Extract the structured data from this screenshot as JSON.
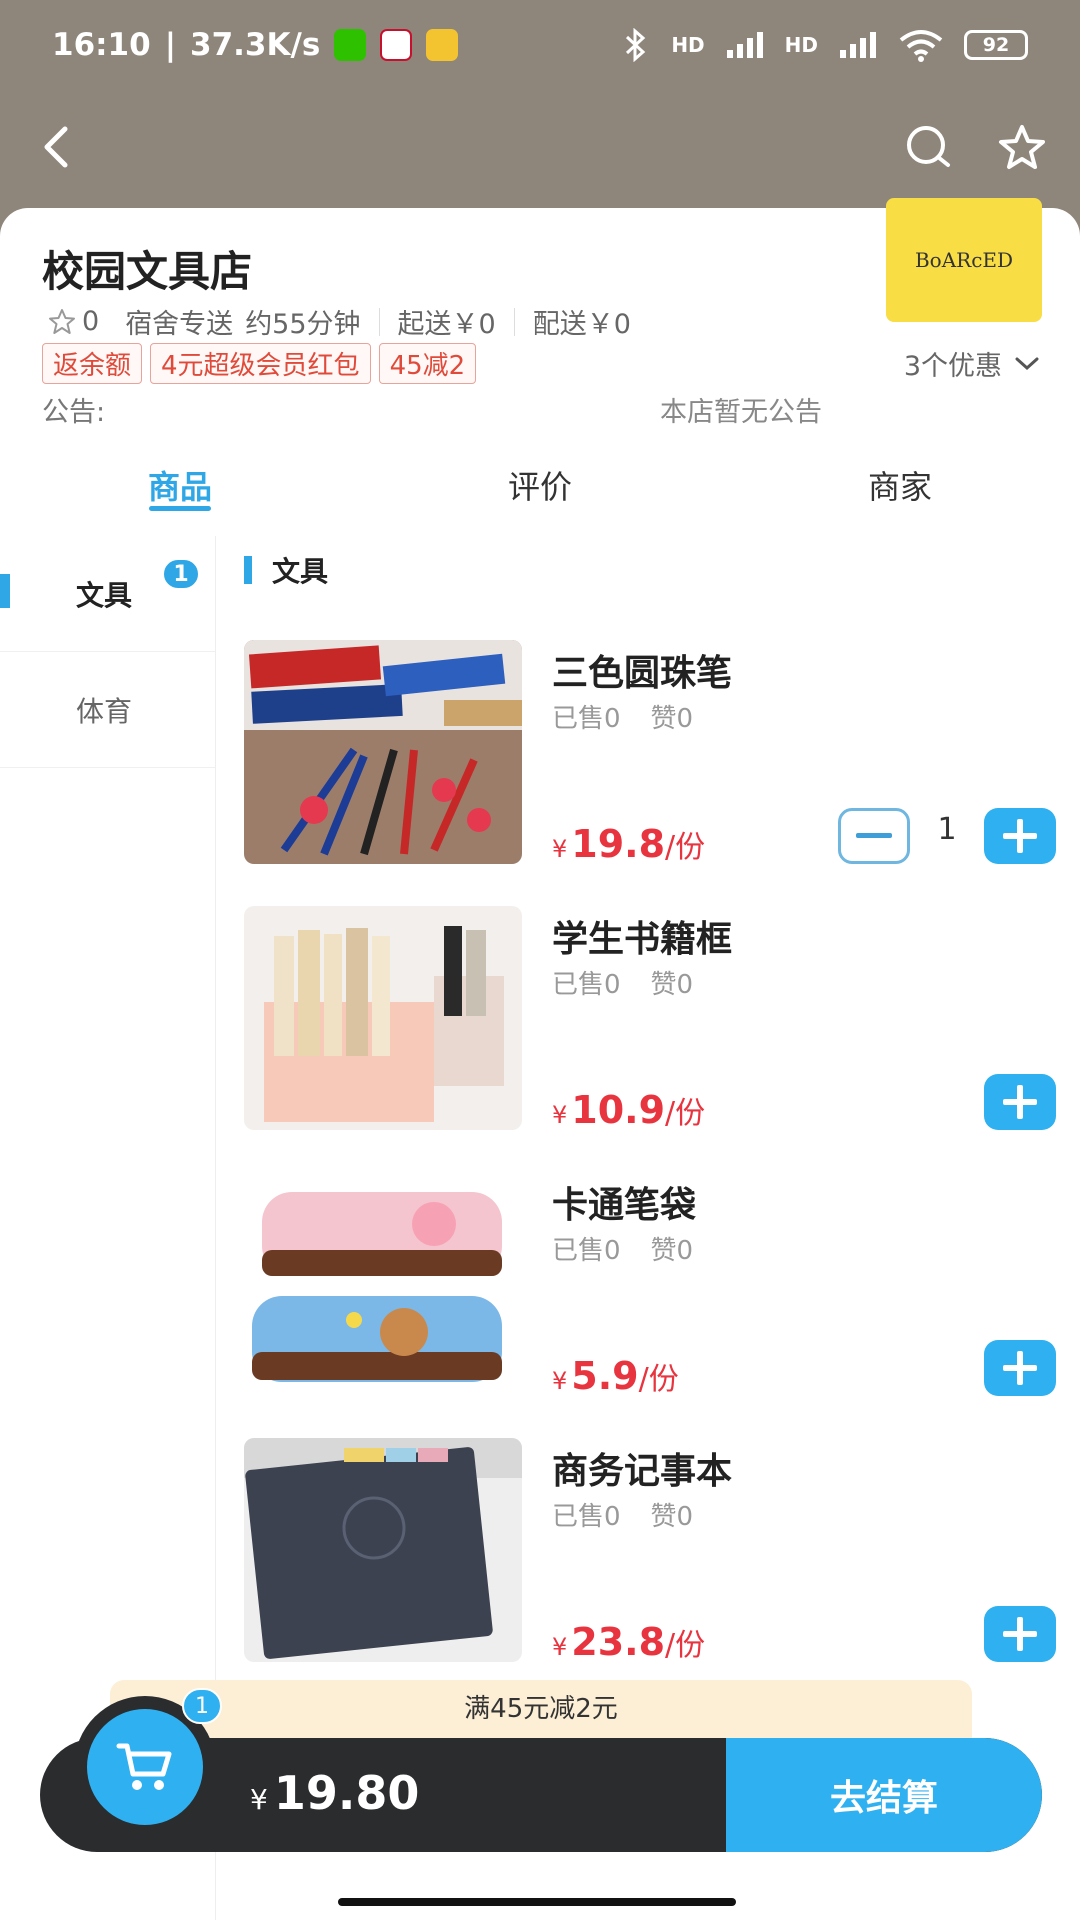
{
  "statusbar": {
    "time": "16:10",
    "speed": "37.3K/s",
    "battery": "92",
    "app_icons": [
      "wechat-icon",
      "kfc-icon",
      "gallery-icon"
    ],
    "signal_labels": [
      "HD",
      "HD"
    ]
  },
  "header": {
    "icons": [
      "back-arrow-icon",
      "search-icon",
      "star-icon"
    ]
  },
  "store": {
    "name": "校园文具店",
    "logo_text": "BoARcED",
    "rating": "0",
    "delivery": "宿舍专送",
    "eta": "约55分钟",
    "min_order": "起送￥0",
    "delivery_fee": "配送￥0",
    "tags": [
      "返余额",
      "4元超级会员红包",
      "45减2"
    ],
    "promo_count": "3个优惠",
    "notice_label": "公告:",
    "notice_text": "本店暂无公告"
  },
  "tabs": [
    {
      "label": "商品",
      "active": true
    },
    {
      "label": "评价",
      "active": false
    },
    {
      "label": "商家",
      "active": false
    }
  ],
  "categories": [
    {
      "label": "文具",
      "badge": "1",
      "active": true
    },
    {
      "label": "体育",
      "badge": "",
      "active": false
    }
  ],
  "section": {
    "title": "文具"
  },
  "products": [
    {
      "name": "三色圆珠笔",
      "sold": "已售0",
      "likes": "赞0",
      "currency": "¥",
      "price": "19.8",
      "unit": "/份",
      "quantity": "1"
    },
    {
      "name": "学生书籍框",
      "sold": "已售0",
      "likes": "赞0",
      "currency": "¥",
      "price": "10.9",
      "unit": "/份",
      "quantity": ""
    },
    {
      "name": "卡通笔袋",
      "sold": "已售0",
      "likes": "赞0",
      "currency": "¥",
      "price": "5.9",
      "unit": "/份",
      "quantity": ""
    },
    {
      "name": "商务记事本",
      "sold": "已售0",
      "likes": "赞0",
      "currency": "¥",
      "price": "23.8",
      "unit": "/份",
      "quantity": ""
    }
  ],
  "cart": {
    "discount_text": "满45元减2元",
    "badge": "1",
    "currency": "¥",
    "total": "19.80",
    "checkout_label": "去结算"
  },
  "colors": {
    "accent": "#2fa7e6",
    "price": "#e8343f",
    "header_bg": "#8f867b",
    "cart_bar": "#2b2c2e",
    "logo_bg": "#f8dd45"
  }
}
